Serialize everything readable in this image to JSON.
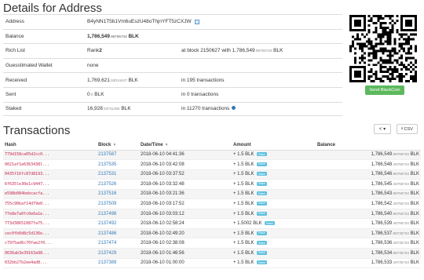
{
  "page_title": "Details for Address",
  "details": {
    "address_label": "Address",
    "address_value": "B4yNN1T5b1Vm6uEszU48oThjnYFT5zCXJW",
    "balance_label": "Balance",
    "balance_main": "1,786,549",
    "balance_decimals": ".96755734",
    "balance_unit": "BLK",
    "rich_label": "Rich List",
    "rich_rank_prefix": "Rank ",
    "rich_rank": "2",
    "rich_block_text_pre": "at block 2150627 with 1,786,549",
    "rich_block_dec": ".96755734",
    "rich_block_unit": "BLK",
    "wallet_label": "Guesstimated Wallet",
    "wallet_value": "none",
    "received_label": "Received",
    "received_main": "1,769,621",
    "received_dec": ".53014447",
    "received_unit": "BLK",
    "received_tx": "in 195 transactions",
    "sent_label": "Sent",
    "sent_main": "0",
    "sent_dec": ".0",
    "sent_unit": "BLK",
    "sent_tx": "in 0 transactions",
    "staked_label": "Staked",
    "staked_main": "16,928",
    "staked_dec": ".43741284",
    "staked_unit": "BLK",
    "staked_tx": "in 11270 transactions"
  },
  "send_button": "Send BlackCoin",
  "transactions_title": "Transactions",
  "nav_button": "< ▾",
  "csv_button": "CSV",
  "table": {
    "headers": {
      "hash": "Hash",
      "block": "Block",
      "date": "Date/Time",
      "amount": "Amount",
      "balance": "Balance"
    },
    "rows": [
      {
        "hash": "779d158ca05d2cc0...",
        "block": "2137587",
        "date": "2018-06-10 04:41:36",
        "amount": "+ 1.5 BLK",
        "tag": "Stake",
        "bal": "1,786,549",
        "bal_dec": ".96755734",
        "unit": "BLK"
      },
      {
        "hash": "0021af1e6363438l...",
        "block": "2137535",
        "date": "2018-06-10 03:42:08",
        "amount": "+ 1.5 BLK",
        "tag": "Stake",
        "bal": "1,786,548",
        "bal_dec": ".46755734",
        "unit": "BLK"
      },
      {
        "hash": "0435f16fc87d8193...",
        "block": "2137531",
        "date": "2018-06-10 03:37:52",
        "amount": "+ 1.5 BLK",
        "tag": "Stake",
        "bal": "1,786,546",
        "bal_dec": ".96755734",
        "unit": "BLK"
      },
      {
        "hash": "6f635le30e1c9447...",
        "block": "2137526",
        "date": "2018-06-10 03:32:48",
        "amount": "+ 1.5 BLK",
        "tag": "Stake",
        "bal": "1,786,545",
        "bal_dec": ".46755734",
        "unit": "BLK"
      },
      {
        "hash": "e598b084bebcacfa...",
        "block": "2137516",
        "date": "2018-06-10 03:21:36",
        "amount": "+ 1.5 BLK",
        "tag": "Stake",
        "bal": "1,786,543",
        "bal_dec": ".96755734",
        "unit": "BLK"
      },
      {
        "hash": "755c90baf14d79e0...",
        "block": "2137509",
        "date": "2018-06-10 03:17:52",
        "amount": "+ 1.5 BLK",
        "tag": "Stake",
        "bal": "1,786,542",
        "bal_dec": ".46755734",
        "unit": "BLK"
      },
      {
        "hash": "77e8e7a0fc0e6a1e...",
        "block": "2137498",
        "date": "2018-06-10 03:03:12",
        "amount": "+ 1.5 BLK",
        "tag": "Stake",
        "bal": "1,786,540",
        "bal_dec": ".96755734",
        "unit": "BLK"
      },
      {
        "hash": "773d38651087fa75...",
        "block": "2137492",
        "date": "2018-06-10 02:58:24",
        "amount": "+ 1.5002 BLK",
        "tag": "Stake",
        "bal": "1,786,539",
        "bal_dec": ".46755734",
        "unit": "BLK"
      },
      {
        "hash": "cec0fb0d8c5d136e...",
        "block": "2137486",
        "date": "2018-06-10 02:49:20",
        "amount": "+ 1.5 BLK",
        "tag": "Stake",
        "bal": "1,786,537",
        "bal_dec": ".96735734",
        "unit": "BLK"
      },
      {
        "hash": "c79f5ad6c70fae2f0...",
        "block": "2137474",
        "date": "2018-06-10 02:38:08",
        "amount": "+ 1.5 BLK",
        "tag": "Stake",
        "bal": "1,786,536",
        "bal_dec": ".46735734",
        "unit": "BLK"
      },
      {
        "hash": "0636ab3e39163a98...",
        "block": "2137429",
        "date": "2018-06-10 01:46:56",
        "amount": "+ 1.5 BLK",
        "tag": "Stake",
        "bal": "1,786,534",
        "bal_dec": ".96735734",
        "unit": "BLK"
      },
      {
        "hash": "032bb27b2ee4ad8...",
        "block": "2137389",
        "date": "2018-06-10 01:00:00",
        "amount": "+ 1.5 BLK",
        "tag": "Stake",
        "bal": "1,786,533",
        "bal_dec": ".46735734",
        "unit": "BLK"
      }
    ]
  }
}
